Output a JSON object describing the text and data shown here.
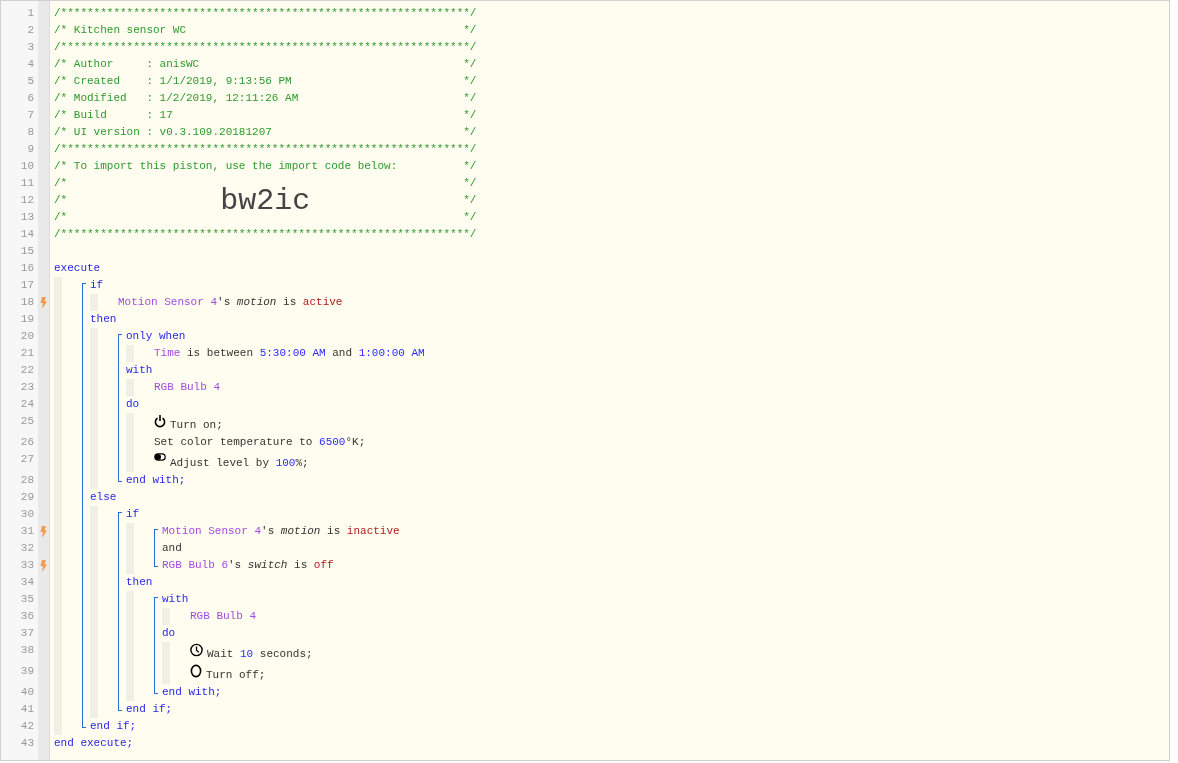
{
  "lines": [
    {
      "kind": "line",
      "number": "1",
      "trigger": false,
      "tokens": [
        {
          "text": "/**************************************************************/",
          "kind": "comment"
        }
      ]
    },
    {
      "kind": "line",
      "number": "2",
      "trigger": false,
      "tokens": [
        {
          "text": "/* Kitchen sensor WC",
          "kind": "comment"
        },
        {
          "text": "*/",
          "kind": "comment"
        }
      ]
    },
    {
      "kind": "line",
      "number": "3",
      "trigger": false,
      "tokens": [
        {
          "text": "/**************************************************************/",
          "kind": "comment"
        }
      ]
    },
    {
      "kind": "line",
      "number": "4",
      "trigger": false,
      "tokens": [
        {
          "text": "/* Author     : anisWC",
          "kind": "comment"
        },
        {
          "text": "*/",
          "kind": "comment"
        }
      ]
    },
    {
      "kind": "line",
      "number": "5",
      "trigger": false,
      "tokens": [
        {
          "text": "/* Created    : 1/1/2019, 9:13:56 PM",
          "kind": "comment"
        },
        {
          "text": "*/",
          "kind": "comment"
        }
      ]
    },
    {
      "kind": "line",
      "number": "6",
      "trigger": false,
      "tokens": [
        {
          "text": "/* Modified   : 1/2/2019, 12:11:26 AM",
          "kind": "comment"
        },
        {
          "text": "*/",
          "kind": "comment"
        }
      ]
    },
    {
      "kind": "line",
      "number": "7",
      "trigger": false,
      "tokens": [
        {
          "text": "/* Build      : 17",
          "kind": "comment"
        },
        {
          "text": "*/",
          "kind": "comment"
        }
      ]
    },
    {
      "kind": "line",
      "number": "8",
      "trigger": false,
      "tokens": [
        {
          "text": "/* UI version : v0.3.109.20181207",
          "kind": "comment"
        },
        {
          "text": "*/",
          "kind": "comment"
        }
      ]
    },
    {
      "kind": "line",
      "number": "9",
      "trigger": false,
      "tokens": [
        {
          "text": "/**************************************************************/",
          "kind": "comment"
        }
      ]
    },
    {
      "kind": "line",
      "number": "10",
      "trigger": false,
      "tokens": [
        {
          "text": "/* To import this piston, use the import code below:",
          "kind": "comment"
        },
        {
          "text": "*/",
          "kind": "comment"
        }
      ]
    },
    {
      "kind": "line",
      "number": "11",
      "trigger": false,
      "tokens": [
        {
          "text": "/*",
          "kind": "comment"
        },
        {
          "text": "*/",
          "kind": "comment"
        }
      ]
    },
    {
      "kind": "line",
      "number": "12",
      "trigger": false,
      "tokens": [
        {
          "text": "/*",
          "kind": "comment"
        },
        {
          "text": "bw2ic",
          "kind": "import_code"
        },
        {
          "text": "*/",
          "kind": "comment"
        }
      ]
    },
    {
      "kind": "line",
      "number": "13",
      "trigger": false,
      "tokens": [
        {
          "text": "/*",
          "kind": "comment"
        },
        {
          "text": "*/",
          "kind": "comment"
        }
      ]
    },
    {
      "kind": "line",
      "number": "14",
      "trigger": false,
      "tokens": [
        {
          "text": "/**************************************************************/",
          "kind": "comment"
        }
      ]
    },
    {
      "kind": "line",
      "number": "15",
      "trigger": false
    },
    {
      "kind": "line",
      "number": "16",
      "trigger": false,
      "tokens": [
        {
          "text": "execute",
          "kind": "keyword"
        }
      ],
      "children": [
        {
          "kind": "bracket",
          "items": [
            {
              "kind": "line",
              "number": "17",
              "trigger": false,
              "tokens": [
                {
                  "text": "if",
                  "kind": "keyword"
                }
              ],
              "children": [
                {
                  "kind": "line",
                  "number": "18",
                  "trigger": true,
                  "tokens": [
                    {
                      "text": "Motion Sensor 4",
                      "kind": "device"
                    },
                    {
                      "text": "'s ",
                      "kind": "text"
                    },
                    {
                      "text": "motion",
                      "kind": "attribute"
                    },
                    {
                      "text": " is ",
                      "kind": "text"
                    },
                    {
                      "text": "active",
                      "kind": "value"
                    }
                  ]
                }
              ]
            },
            {
              "kind": "line",
              "number": "19",
              "trigger": false,
              "tokens": [
                {
                  "text": "then",
                  "kind": "keyword"
                }
              ],
              "children": [
                {
                  "kind": "bracket",
                  "items": [
                    {
                      "kind": "line",
                      "number": "20",
                      "trigger": false,
                      "tokens": [
                        {
                          "text": "only when",
                          "kind": "keyword"
                        }
                      ],
                      "children": [
                        {
                          "kind": "line",
                          "number": "21",
                          "trigger": false,
                          "tokens": [
                            {
                              "text": "Time",
                              "kind": "device"
                            },
                            {
                              "text": " is between ",
                              "kind": "text"
                            },
                            {
                              "text": "5:30:00 AM",
                              "kind": "number"
                            },
                            {
                              "text": " and ",
                              "kind": "text"
                            },
                            {
                              "text": "1:00:00 AM",
                              "kind": "number"
                            }
                          ]
                        }
                      ]
                    },
                    {
                      "kind": "line",
                      "number": "22",
                      "trigger": false,
                      "tokens": [
                        {
                          "text": "with",
                          "kind": "keyword"
                        }
                      ],
                      "children": [
                        {
                          "kind": "line",
                          "number": "23",
                          "trigger": false,
                          "tokens": [
                            {
                              "text": "RGB Bulb 4",
                              "kind": "device"
                            }
                          ]
                        }
                      ]
                    },
                    {
                      "kind": "line",
                      "number": "24",
                      "trigger": false,
                      "tokens": [
                        {
                          "text": "do",
                          "kind": "keyword"
                        }
                      ],
                      "children": [
                        {
                          "kind": "on_task",
                          "number": "25",
                          "trigger": false,
                          "tokens": [
                            {
                              "text": "Turn on;",
                              "kind": "text"
                            }
                          ]
                        },
                        {
                          "kind": "line",
                          "number": "26",
                          "trigger": false,
                          "tokens": [
                            {
                              "text": "Set color temperature to ",
                              "kind": "text"
                            },
                            {
                              "text": "6500",
                              "kind": "number"
                            },
                            {
                              "text": "°K;",
                              "kind": "text"
                            }
                          ]
                        },
                        {
                          "kind": "level_task",
                          "number": "27",
                          "trigger": false,
                          "tokens": [
                            {
                              "text": "Adjust level by ",
                              "kind": "text"
                            },
                            {
                              "text": "100",
                              "kind": "number"
                            },
                            {
                              "text": "%;",
                              "kind": "text"
                            }
                          ]
                        }
                      ]
                    },
                    {
                      "kind": "line",
                      "number": "28",
                      "trigger": false,
                      "tokens": [
                        {
                          "text": "end with;",
                          "kind": "keyword"
                        }
                      ]
                    }
                  ]
                }
              ]
            },
            {
              "kind": "line",
              "number": "29",
              "trigger": false,
              "tokens": [
                {
                  "text": "else",
                  "kind": "keyword"
                }
              ],
              "children": [
                {
                  "kind": "bracket",
                  "items": [
                    {
                      "kind": "line",
                      "number": "30",
                      "trigger": false,
                      "tokens": [
                        {
                          "text": "if",
                          "kind": "keyword"
                        }
                      ],
                      "children": [
                        {
                          "kind": "bracket",
                          "items": [
                            {
                              "kind": "line",
                              "number": "31",
                              "trigger": true,
                              "tokens": [
                                {
                                  "text": "Motion Sensor 4",
                                  "kind": "device"
                                },
                                {
                                  "text": "'s ",
                                  "kind": "text"
                                },
                                {
                                  "text": "motion",
                                  "kind": "attribute"
                                },
                                {
                                  "text": " is ",
                                  "kind": "text"
                                },
                                {
                                  "text": "inactive",
                                  "kind": "value"
                                }
                              ]
                            },
                            {
                              "kind": "line",
                              "number": "32",
                              "trigger": false,
                              "tokens": [
                                {
                                  "text": "and",
                                  "kind": "text"
                                }
                              ]
                            },
                            {
                              "kind": "line",
                              "number": "33",
                              "trigger": true,
                              "tokens": [
                                {
                                  "text": "RGB Bulb 6",
                                  "kind": "device"
                                },
                                {
                                  "text": "'s ",
                                  "kind": "text"
                                },
                                {
                                  "text": "switch",
                                  "kind": "attribute"
                                },
                                {
                                  "text": " is ",
                                  "kind": "text"
                                },
                                {
                                  "text": "off",
                                  "kind": "value"
                                }
                              ]
                            }
                          ]
                        }
                      ]
                    },
                    {
                      "kind": "line",
                      "number": "34",
                      "trigger": false,
                      "tokens": [
                        {
                          "text": "then",
                          "kind": "keyword"
                        }
                      ],
                      "children": [
                        {
                          "kind": "bracket",
                          "items": [
                            {
                              "kind": "line",
                              "number": "35",
                              "trigger": false,
                              "tokens": [
                                {
                                  "text": "with",
                                  "kind": "keyword"
                                }
                              ],
                              "children": [
                                {
                                  "kind": "line",
                                  "number": "36",
                                  "trigger": false,
                                  "tokens": [
                                    {
                                      "text": "RGB Bulb 4",
                                      "kind": "device"
                                    }
                                  ]
                                }
                              ]
                            },
                            {
                              "kind": "line",
                              "number": "37",
                              "trigger": false,
                              "tokens": [
                                {
                                  "text": "do",
                                  "kind": "keyword"
                                }
                              ],
                              "children": [
                                {
                                  "kind": "wait_task",
                                  "number": "38",
                                  "trigger": false,
                                  "tokens": [
                                    {
                                      "text": "Wait ",
                                      "kind": "text"
                                    },
                                    {
                                      "text": "10",
                                      "kind": "number"
                                    },
                                    {
                                      "text": " seconds;",
                                      "kind": "text"
                                    }
                                  ]
                                },
                                {
                                  "kind": "off_task",
                                  "number": "39",
                                  "trigger": false,
                                  "tokens": [
                                    {
                                      "text": "Turn off;",
                                      "kind": "text"
                                    }
                                  ]
                                }
                              ]
                            },
                            {
                              "kind": "line",
                              "number": "40",
                              "trigger": false,
                              "tokens": [
                                {
                                  "text": "end with;",
                                  "kind": "keyword"
                                }
                              ]
                            }
                          ]
                        }
                      ]
                    },
                    {
                      "kind": "line",
                      "number": "41",
                      "trigger": false,
                      "tokens": [
                        {
                          "text": "end if;",
                          "kind": "keyword"
                        }
                      ]
                    }
                  ]
                }
              ]
            },
            {
              "kind": "line",
              "number": "42",
              "trigger": false,
              "tokens": [
                {
                  "text": "end if;",
                  "kind": "keyword"
                }
              ]
            }
          ]
        }
      ]
    },
    {
      "kind": "line",
      "number": "43",
      "trigger": false,
      "tokens": [
        {
          "text": "end execute;",
          "kind": "keyword"
        }
      ]
    }
  ]
}
